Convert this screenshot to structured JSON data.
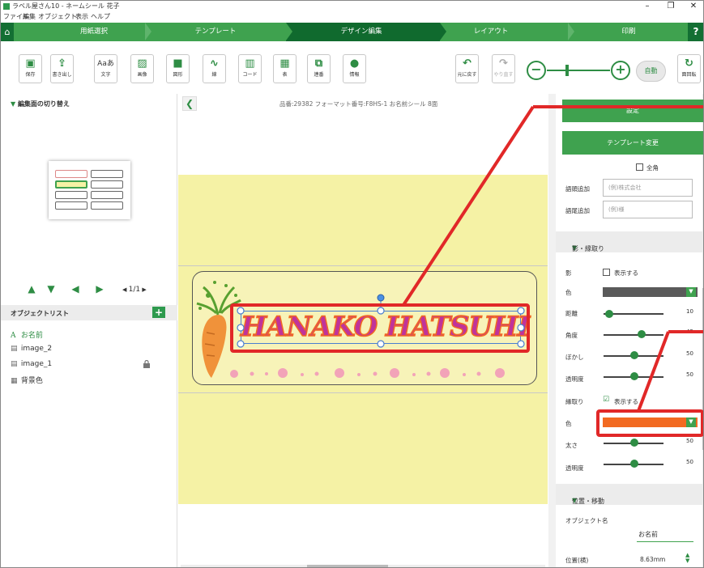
{
  "app": {
    "title": "ラベル屋さん10 - ネームシール 花子"
  },
  "window_controls": {
    "minimize": "–",
    "restore": "❐",
    "close": "✕"
  },
  "menu": [
    "ファイル",
    "編集",
    "オブジェクト",
    "表示",
    "ヘルプ"
  ],
  "steps": [
    "用紙選択",
    "テンプレート",
    "デザイン編集",
    "レイアウト",
    "印刷"
  ],
  "help": "?",
  "toolbar": {
    "save": "保存",
    "export": "書き出し",
    "text": "文字",
    "text_icon": "Aaあ",
    "image": "画像",
    "shape": "図形",
    "line": "線",
    "code": "コード",
    "table": "表",
    "serial": "連番",
    "info": "情報",
    "undo": "元に戻す",
    "redo": "やり直す",
    "auto": "自動",
    "rotate": "面回転"
  },
  "left_panel": {
    "edit_switch": "編集面の切り替え",
    "page_indicator": "1/1",
    "object_list_title": "オブジェクトリスト",
    "objects": [
      {
        "icon": "A",
        "name": "お名前"
      },
      {
        "icon": "▤",
        "name": "image_2"
      },
      {
        "icon": "▤",
        "name": "image_1"
      },
      {
        "icon": "▦",
        "name": "背景色"
      }
    ]
  },
  "canvas": {
    "format_info": "品番:29382 フォーマット番号:F8HS-1 お名前シール 8面",
    "label_text": "HANAKO HATSUHI"
  },
  "right_panel": {
    "top_button": "設定",
    "template_button": "テンプレート変更",
    "fullwidth": "全角",
    "prefix_label": "語頭追加",
    "prefix_placeholder": "(例)株式会社",
    "suffix_label": "語尾追加",
    "suffix_placeholder": "(例)様",
    "section_shadow": "影・縁取り",
    "shadow_label": "影",
    "show": "表示する",
    "color_label": "色",
    "distance_label": "距離",
    "distance_value": "10",
    "angle_label": "角度",
    "angle_value": "45",
    "blur_label": "ぼかし",
    "blur_value": "50",
    "opacity_label": "透明度",
    "opacity_value": "50",
    "outline_label": "縁取り",
    "outline_show": "表示する",
    "outline_color_label": "色",
    "thickness_label": "太さ",
    "thickness_value": "50",
    "outline_opacity_label": "透明度",
    "outline_opacity_value": "50",
    "section_position": "位置・移動",
    "objname_label": "オブジェクト名",
    "objname_value": "お名前",
    "posx_label": "位置(横)",
    "posx_value": "8.63mm"
  },
  "colors": {
    "accent": "#3fa24f",
    "accent_dark": "#106a2e",
    "shadow_color": "#5a5a5a",
    "outline_color": "#f26a21",
    "label_text": "#c0339a",
    "annotation": "#e12828",
    "label_bg": "#f5f2a5"
  },
  "slider_levels": {
    "distance": 0.1,
    "angle": 0.45,
    "blur": 0.5,
    "opacity": 0.5,
    "thickness": 0.5,
    "outline_opacity": 0.5,
    "zoom": 0.3
  }
}
